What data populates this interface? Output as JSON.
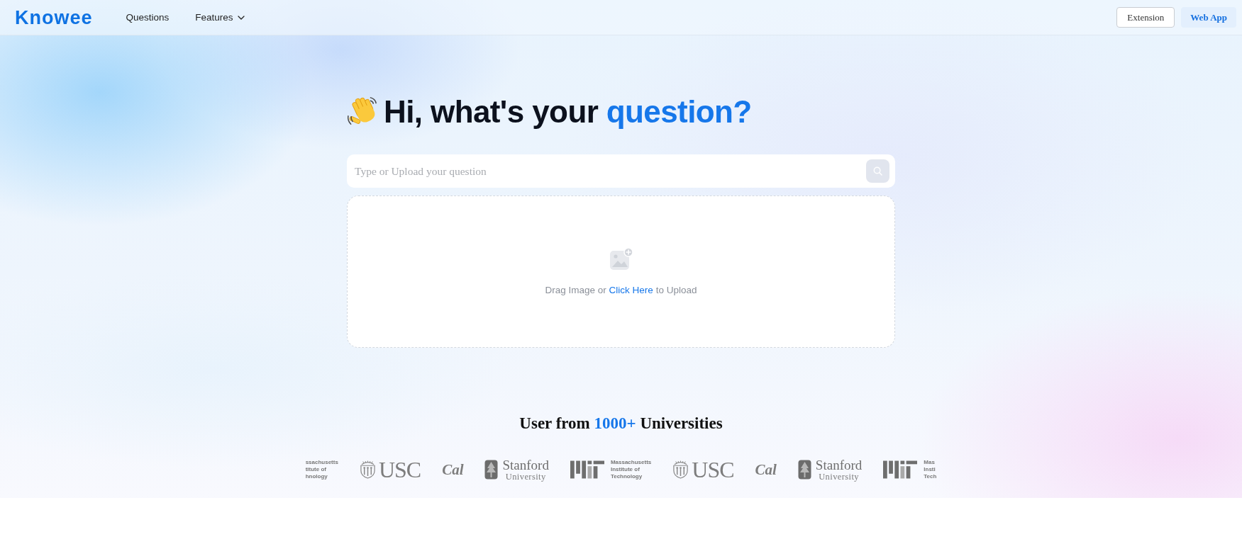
{
  "nav": {
    "logo": "Knowee",
    "links": [
      {
        "label": "Questions",
        "kind": "link"
      },
      {
        "label": "Features",
        "kind": "dropdown"
      }
    ],
    "buttons": [
      {
        "label": "Extension",
        "kind": "outline"
      },
      {
        "label": "Web App",
        "kind": "filled"
      }
    ]
  },
  "hero": {
    "title": "Hi, what's your",
    "title_highlight": "question?"
  },
  "search": {
    "placeholder": "Type or Upload your question"
  },
  "upload": {
    "text_before": "Drag Image or",
    "link": "Click Here",
    "text_after": "to Upload"
  },
  "universities": {
    "prefix": "User from",
    "count": "1000+",
    "suffix": "Universities"
  },
  "logos": [
    {
      "kind": "text",
      "lines": [
        "ssachusetts",
        "titute of",
        "hnology"
      ]
    },
    {
      "kind": "usc",
      "name": "USC"
    },
    {
      "kind": "cal",
      "name": "Cal"
    },
    {
      "kind": "stanford",
      "name": "Stanford",
      "subtitle": "University"
    },
    {
      "kind": "mit",
      "lines": [
        "Massachusetts",
        "Institute of",
        "Technology"
      ]
    },
    {
      "kind": "usc",
      "name": "USC"
    },
    {
      "kind": "cal",
      "name": "Cal"
    },
    {
      "kind": "stanford",
      "name": "Stanford",
      "subtitle": "University"
    },
    {
      "kind": "mit",
      "lines": [
        "Mas",
        "Insti",
        "Tech"
      ]
    }
  ]
}
